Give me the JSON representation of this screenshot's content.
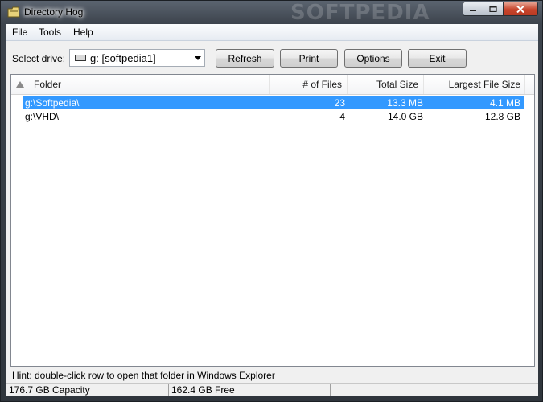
{
  "window": {
    "title": "Directory Hog",
    "watermark": "SOFTPEDIA",
    "caption_buttons": [
      "minimize-icon",
      "maximize-icon",
      "close-icon"
    ]
  },
  "menu": {
    "items": [
      "File",
      "Tools",
      "Help"
    ]
  },
  "toolbar": {
    "drive_label": "Select drive:",
    "drive_value": "g: [softpedia1]",
    "refresh": "Refresh",
    "print": "Print",
    "options": "Options",
    "exit": "Exit"
  },
  "list": {
    "columns": [
      "Folder",
      "# of Files",
      "Total Size",
      "Largest File Size"
    ],
    "rows": [
      {
        "folder": "g:\\Softpedia\\",
        "files": "23",
        "total": "13.3 MB",
        "largest": "4.1 MB",
        "selected": true
      },
      {
        "folder": "g:\\VHD\\",
        "files": "4",
        "total": "14.0 GB",
        "largest": "12.8 GB",
        "selected": false
      }
    ]
  },
  "hint": "Hint: double-click row to open that folder in Windows Explorer",
  "status": {
    "capacity": "176.7 GB Capacity",
    "free": "162.4 GB Free"
  },
  "colors": {
    "selection": "#3399ff",
    "close_button": "#c7452c"
  }
}
